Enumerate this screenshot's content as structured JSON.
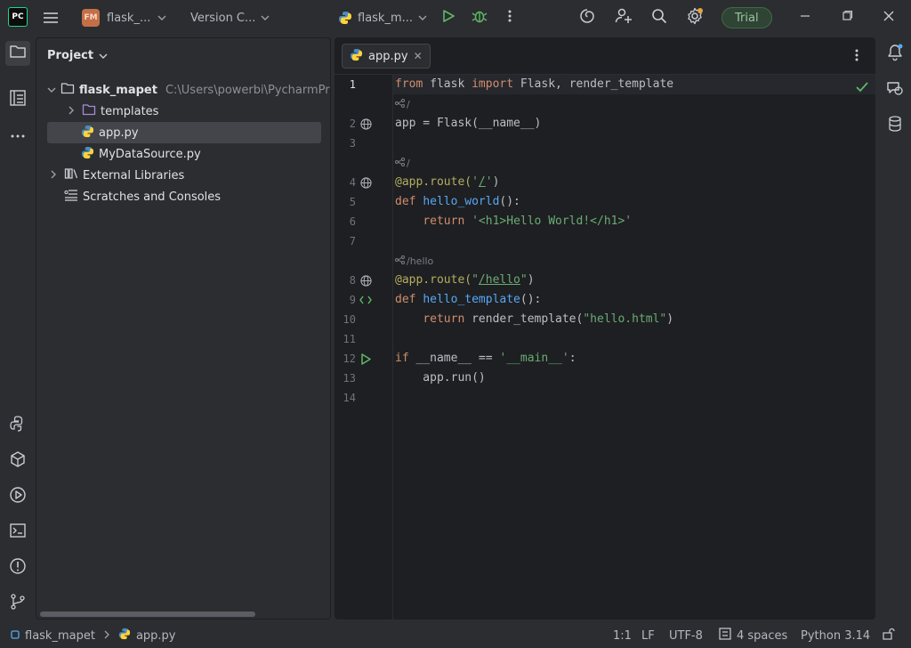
{
  "titlebar": {
    "app_logo": "PC",
    "project_badge": "FM",
    "project_name": "flask_...",
    "vcs_label": "Version C...",
    "run_config": "flask_m...",
    "trial_label": "Trial"
  },
  "project_panel": {
    "title": "Project",
    "tree": [
      {
        "label": "flask_mapet",
        "path": "C:\\Users\\powerbi\\PycharmProje"
      },
      {
        "label": "templates"
      },
      {
        "label": "app.py"
      },
      {
        "label": "MyDataSource.py"
      },
      {
        "label": "External Libraries"
      },
      {
        "label": "Scratches and Consoles"
      }
    ]
  },
  "editor": {
    "tab_label": "app.py",
    "tab_close": "✕",
    "line_numbers": [
      "1",
      "2",
      "3",
      "4",
      "5",
      "6",
      "7",
      "8",
      "9",
      "10",
      "11",
      "12",
      "13",
      "14"
    ],
    "hints": [
      "/",
      "/",
      "/hello"
    ],
    "code": {
      "l1_from": "from",
      "l1_mod": " flask ",
      "l1_import": "import",
      "l1_rest": " Flask, render_template",
      "l2": "app = Flask(__name__)",
      "l4_dec": "@app.route(",
      "l4_q1": "'",
      "l4_path": "/",
      "l4_q2": "'",
      "l4_close": ")",
      "l5_def": "def",
      "l5_fn": "hello_world",
      "l5_rest": "():",
      "l6_indent": "    ",
      "l6_return": "return",
      "l6_str": " '<h1>Hello World!</h1>'",
      "l8_dec": "@app.route(",
      "l8_q1": "\"",
      "l8_path": "/hello",
      "l8_q2": "\"",
      "l8_close": ")",
      "l9_def": "def",
      "l9_fn": "hello_template",
      "l9_rest": "():",
      "l10_indent": "    ",
      "l10_return": "return",
      "l10_call": " render_template(",
      "l10_str": "\"hello.html\"",
      "l10_close": ")",
      "l12_if": "if",
      "l12_mid": " __name__ == ",
      "l12_str": "'__main__'",
      "l12_colon": ":",
      "l13": "    app.run()"
    }
  },
  "statusbar": {
    "breadcrumb_project": "flask_mapet",
    "breadcrumb_file": "app.py",
    "position": "1:1",
    "line_sep": "LF",
    "encoding": "UTF-8",
    "indent": "4 spaces",
    "interpreter": "Python 3.14"
  },
  "colors": {
    "background": "#2b2d30",
    "editor_bg": "#1e1f22",
    "keyword": "#cf8e6d",
    "function": "#56a8f5",
    "string": "#6aab73",
    "decorator": "#b3ae60",
    "trial_green": "#98c39f"
  },
  "icons": [
    "pycharm-logo",
    "hamburger-icon",
    "chevron-down-icon",
    "python-file-icon",
    "run-icon",
    "debug-icon",
    "more-icon",
    "ai-spiral-icon",
    "add-user-icon",
    "search-icon",
    "settings-icon",
    "minimize-icon",
    "maximize-icon",
    "close-icon",
    "folder-icon",
    "structure-icon",
    "notifications-icon",
    "ai-chat-icon",
    "database-icon",
    "python-console-icon",
    "python-packages-icon",
    "services-icon",
    "terminal-icon",
    "problems-icon",
    "git-icon",
    "globe-icon",
    "route-hint-icon",
    "checkmark-icon",
    "lock-icon"
  ]
}
